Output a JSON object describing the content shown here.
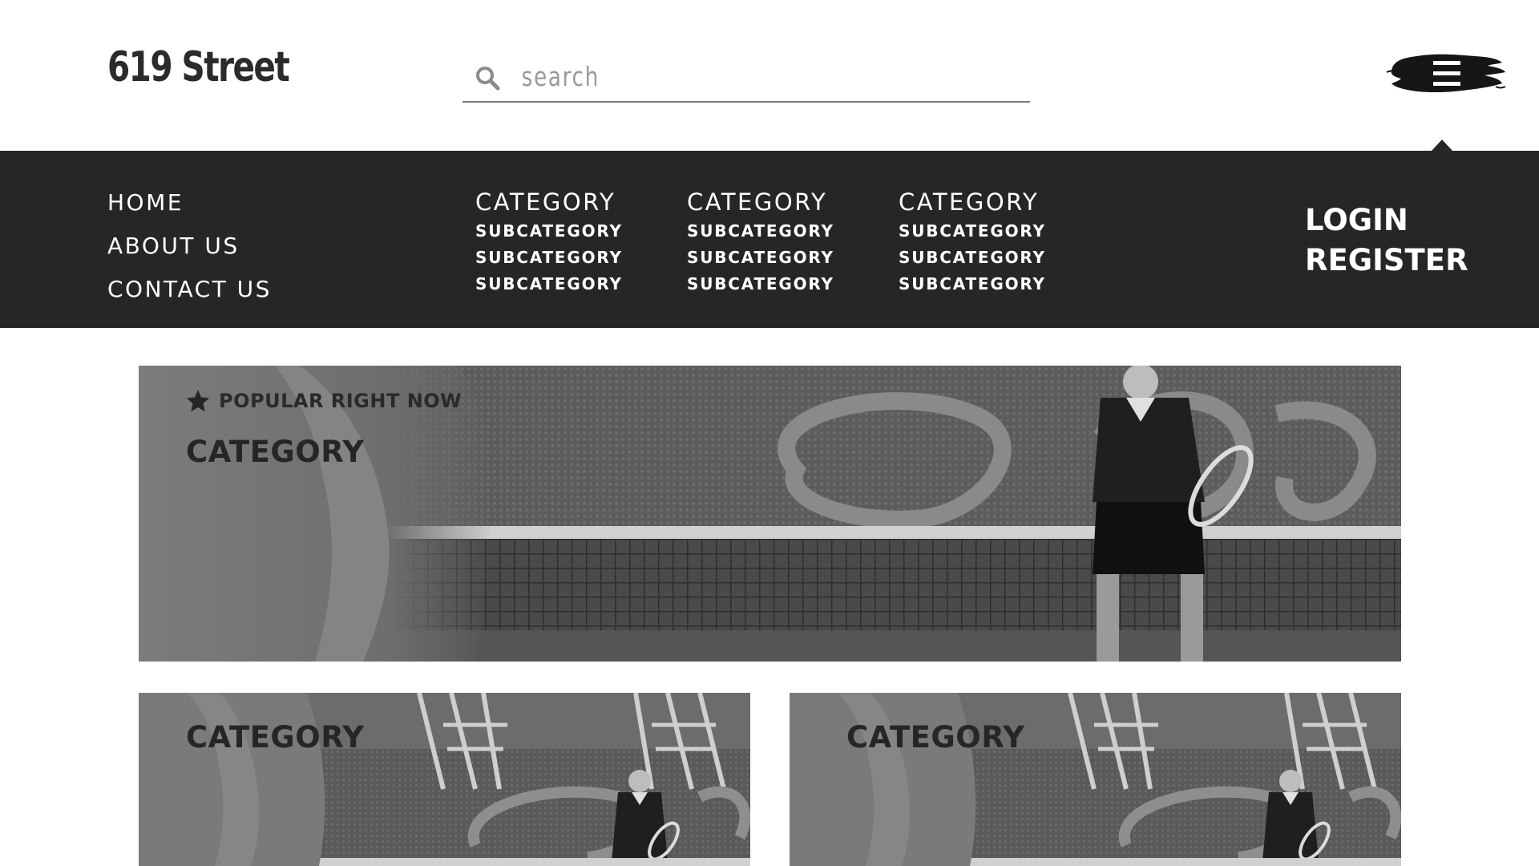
{
  "header": {
    "logo": "619 Street",
    "search_placeholder": "search",
    "menu_icon": "hamburger-menu-icon"
  },
  "nav": {
    "main_links": [
      "HOME",
      "ABOUT US",
      "CONTACT US"
    ],
    "categories": [
      {
        "title": "CATEGORY",
        "subcategories": [
          "SUBCATEGORY",
          "SUBCATEGORY",
          "SUBCATEGORY"
        ]
      },
      {
        "title": "CATEGORY",
        "subcategories": [
          "SUBCATEGORY",
          "SUBCATEGORY",
          "SUBCATEGORY"
        ]
      },
      {
        "title": "CATEGORY",
        "subcategories": [
          "SUBCATEGORY",
          "SUBCATEGORY",
          "SUBCATEGORY"
        ]
      }
    ],
    "auth": {
      "login": "LOGIN",
      "register": "REGISTER"
    }
  },
  "content": {
    "hero": {
      "badge_icon": "star-icon",
      "badge": "POPULAR RIGHT NOW",
      "title": "CATEGORY"
    },
    "cards": [
      {
        "title": "CATEGORY"
      },
      {
        "title": "CATEGORY"
      }
    ]
  },
  "colors": {
    "nav_background": "#262626",
    "text_dark": "#2b2b2b",
    "search_underline": "#7a7a7a",
    "placeholder": "#9a9a9a"
  }
}
